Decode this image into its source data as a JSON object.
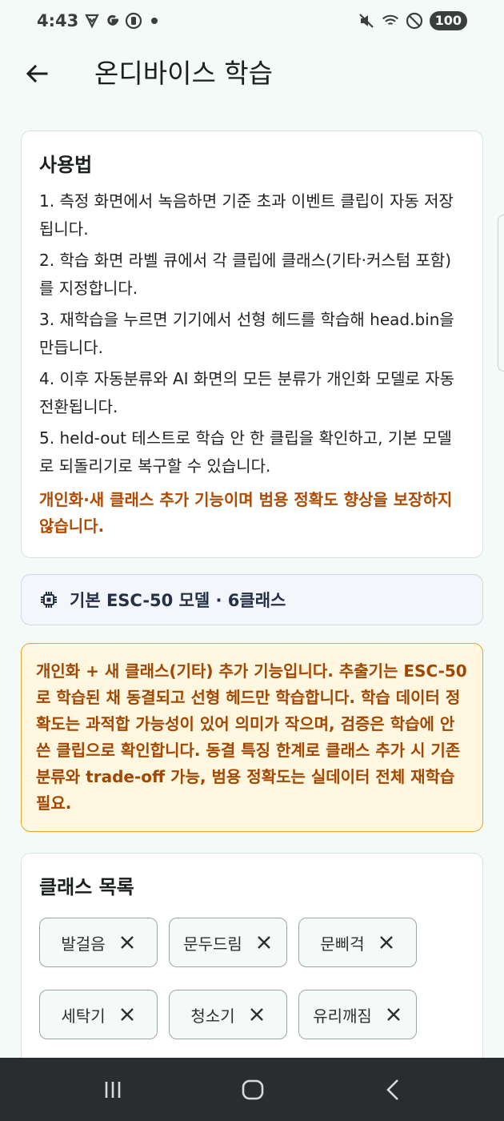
{
  "status_bar": {
    "time": "4:43",
    "battery": "100",
    "left_icons": [
      "shield-check-icon",
      "google-g-icon",
      "badge-icon",
      "dot-icon"
    ],
    "right_icons": [
      "mute-icon",
      "wifi-icon",
      "do-not-disturb-icon"
    ]
  },
  "app_bar": {
    "title": "온디바이스 학습",
    "back_icon": "arrow-left-icon"
  },
  "usage": {
    "title": "사용법",
    "steps": [
      "1. 측정 화면에서 녹음하면 기준 초과 이벤트 클립이 자동 저장됩니다.",
      "2. 학습 화면 라벨 큐에서 각 클립에 클래스(기타·커스텀 포함)를 지정합니다.",
      "3. 재학습을 누르면 기기에서 선형 헤드를 학습해 head.bin을 만듭니다.",
      "4. 이후 자동분류와 AI 화면의 모든 분류가 개인화 모델로 자동 전환됩니다.",
      "5. held-out 테스트로 학습 안 한 클립을 확인하고, 기본 모델로 되돌리기로 복구할 수 있습니다."
    ],
    "warning": "개인화·새 클래스 추가 기능이며 범용 정확도 향상을 보장하지 않습니다."
  },
  "model": {
    "icon": "chip-icon",
    "label": "기본 ESC-50 모델 · 6클래스"
  },
  "notice": {
    "text": "개인화 + 새 클래스(기타) 추가 기능입니다. 추출기는 ESC-50로 학습된 채 동결되고 선형 헤드만 학습합니다. 학습 데이터 정확도는 과적합 가능성이 있어 의미가 작으며, 검증은 학습에 안 쓴 클립으로 확인합니다. 동결 특징 한계로 클래스 추가 시 기존 분류와 trade-off 가능, 범용 정확도는 실데이터 전체 재학습 필요."
  },
  "classes": {
    "title": "클래스 목록",
    "items": [
      {
        "label": "발걸음"
      },
      {
        "label": "문두드림"
      },
      {
        "label": "문삐걱"
      },
      {
        "label": "세탁기"
      },
      {
        "label": "청소기"
      },
      {
        "label": "유리깨짐"
      }
    ]
  },
  "colors": {
    "background": "#f4faf7",
    "warning": "#b04a00",
    "notice_bg": "#fff7e0",
    "notice_border": "#e8a42e",
    "model_text": "#253047",
    "navbar": "#2a2c2e"
  },
  "nav_bar": {
    "icons": [
      "recent-apps-icon",
      "home-icon",
      "back-icon"
    ]
  }
}
